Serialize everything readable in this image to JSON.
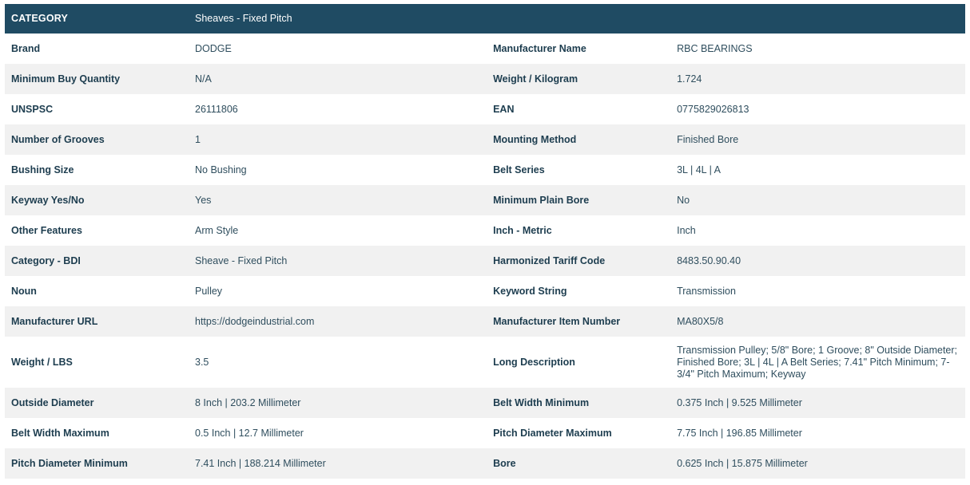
{
  "header": {
    "label": "CATEGORY",
    "value": "Sheaves - Fixed Pitch"
  },
  "rows": [
    {
      "l1": "Brand",
      "v1": "DODGE",
      "l2": "Manufacturer Name",
      "v2": "RBC BEARINGS"
    },
    {
      "l1": "Minimum Buy Quantity",
      "v1": "N/A",
      "l2": "Weight / Kilogram",
      "v2": "1.724"
    },
    {
      "l1": "UNSPSC",
      "v1": "26111806",
      "l2": "EAN",
      "v2": "0775829026813"
    },
    {
      "l1": "Number of Grooves",
      "v1": "1",
      "l2": "Mounting Method",
      "v2": "Finished Bore"
    },
    {
      "l1": "Bushing Size",
      "v1": "No Bushing",
      "l2": "Belt Series",
      "v2": "3L | 4L | A"
    },
    {
      "l1": "Keyway Yes/No",
      "v1": "Yes",
      "l2": "Minimum Plain Bore",
      "v2": "No"
    },
    {
      "l1": "Other Features",
      "v1": "Arm Style",
      "l2": "Inch - Metric",
      "v2": "Inch"
    },
    {
      "l1": "Category - BDI",
      "v1": "Sheave - Fixed Pitch",
      "l2": "Harmonized Tariff Code",
      "v2": "8483.50.90.40"
    },
    {
      "l1": "Noun",
      "v1": "Pulley",
      "l2": "Keyword String",
      "v2": "Transmission"
    },
    {
      "l1": "Manufacturer URL",
      "v1": "https://dodgeindustrial.com",
      "l2": "Manufacturer Item Number",
      "v2": "MA80X5/8"
    },
    {
      "l1": "Weight / LBS",
      "v1": "3.5",
      "l2": "Long Description",
      "v2": "Transmission Pulley; 5/8\" Bore; 1 Groove; 8\" Outside Diameter; Finished Bore; 3L | 4L | A Belt Series; 7.41\" Pitch Minimum; 7-3/4\" Pitch Maximum; Keyway"
    },
    {
      "l1": "Outside Diameter",
      "v1": "8 Inch | 203.2 Millimeter",
      "l2": "Belt Width Minimum",
      "v2": "0.375 Inch | 9.525 Millimeter"
    },
    {
      "l1": "Belt Width Maximum",
      "v1": "0.5 Inch | 12.7 Millimeter",
      "l2": "Pitch Diameter Maximum",
      "v2": "7.75 Inch | 196.85 Millimeter"
    },
    {
      "l1": "Pitch Diameter Minimum",
      "v1": "7.41 Inch | 188.214 Millimeter",
      "l2": "Bore",
      "v2": "0.625 Inch | 15.875 Millimeter"
    }
  ]
}
